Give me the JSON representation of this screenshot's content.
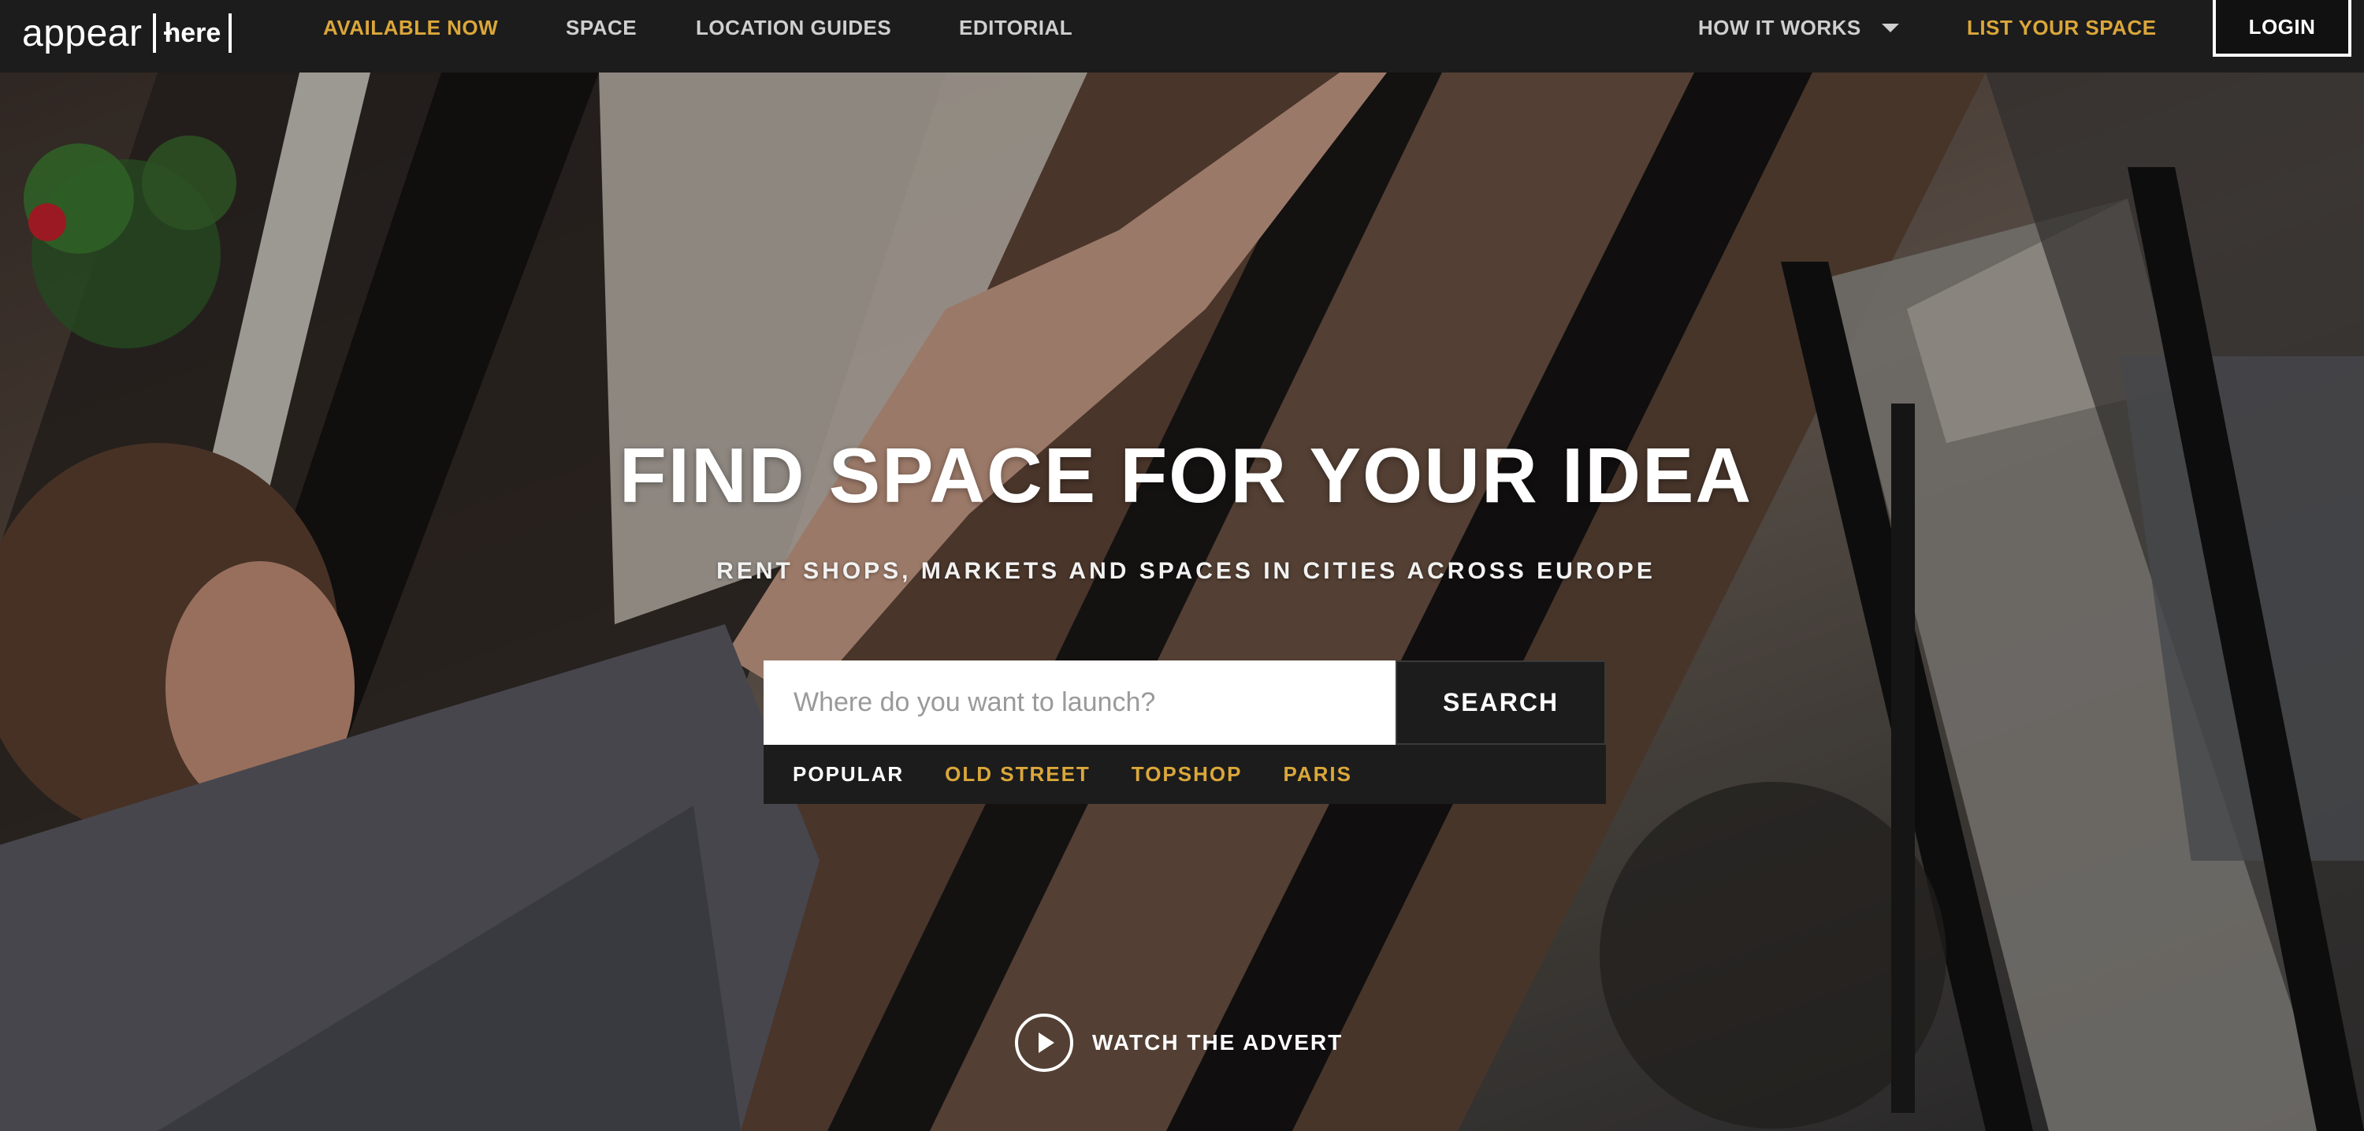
{
  "header": {
    "logo_word": "appear",
    "logo_box": "here",
    "nav": {
      "available_now": "AVAILABLE NOW",
      "space": "SPACE",
      "location_guides": "LOCATION GUIDES",
      "editorial": "EDITORIAL",
      "how_it_works": "HOW IT WORKS",
      "list_your_space": "LIST YOUR SPACE",
      "login": "LOGIN"
    }
  },
  "hero": {
    "title": "FIND SPACE FOR YOUR IDEA",
    "subtitle": "RENT SHOPS, MARKETS AND SPACES IN CITIES ACROSS EUROPE",
    "search": {
      "placeholder": "Where do you want to launch?",
      "value": "",
      "button": "SEARCH"
    },
    "popular": {
      "label": "POPULAR",
      "links": [
        "OLD STREET",
        "TOPSHOP",
        "PARIS"
      ]
    },
    "watch_advert": "WATCH THE ADVERT"
  },
  "colors": {
    "accent_gold": "#dba73a",
    "nav_bg": "#1c1c1c",
    "text_white": "#ffffff"
  },
  "icons": {
    "caret": "chevron-down-icon",
    "play": "play-icon"
  }
}
